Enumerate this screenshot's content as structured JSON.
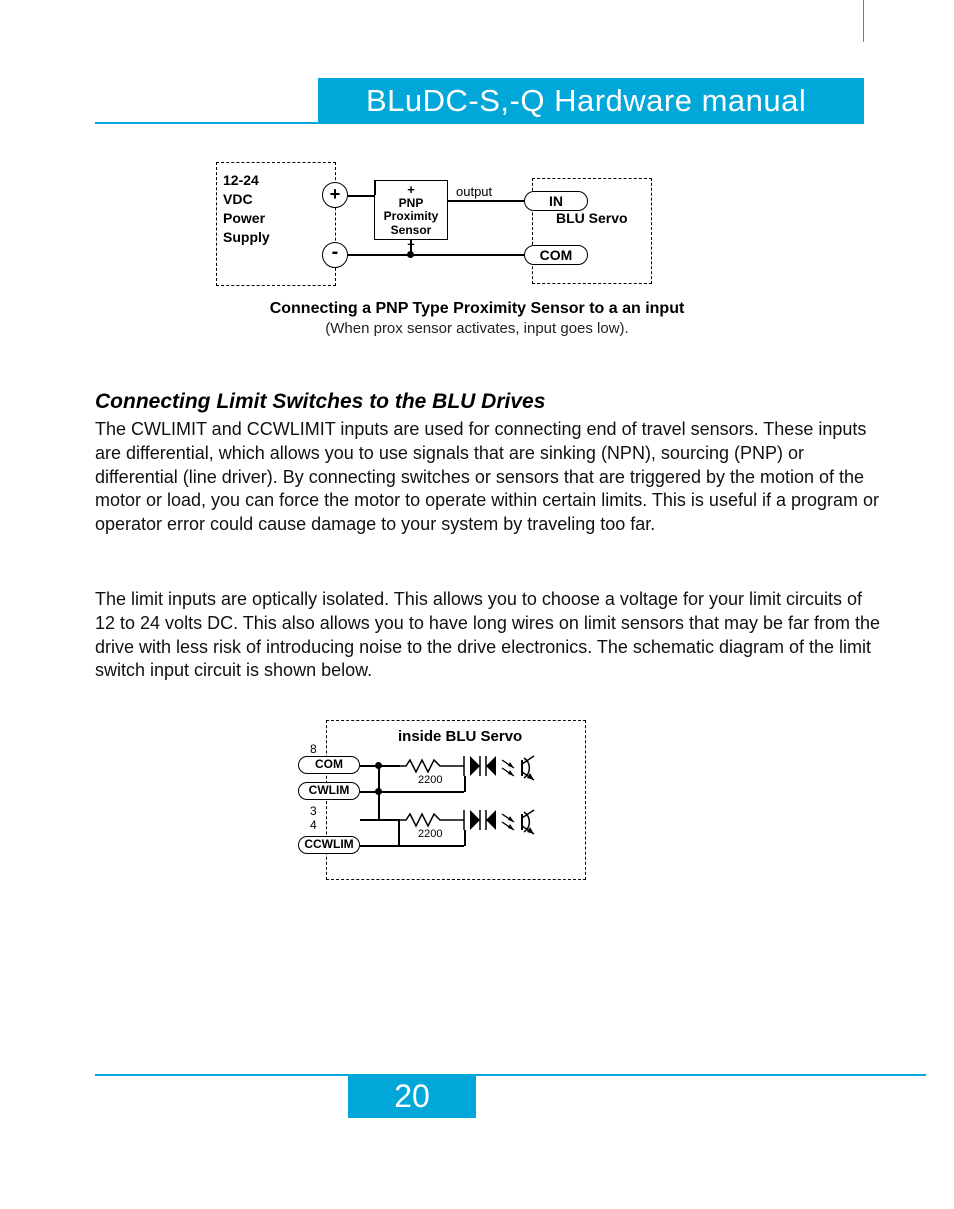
{
  "header": {
    "title": "BLuDC-S,-Q Hardware manual"
  },
  "diag1": {
    "ps_line1": "12-24",
    "ps_line2": "VDC",
    "ps_line3": "Power",
    "ps_line4": "Supply",
    "plus": "+",
    "minus": "-",
    "sensor_plus": "+",
    "sensor_l1": "PNP",
    "sensor_l2": "Proximity",
    "sensor_l3": "Sensor",
    "sensor_minus": "–",
    "output": "output",
    "in": "IN",
    "com": "COM",
    "servo": "BLU Servo",
    "caption1": "Connecting a PNP Type Proximity Sensor to a an input",
    "caption2": "(When prox sensor activates, input goes low)."
  },
  "section": {
    "heading": "Connecting Limit Switches to the BLU Drives",
    "p1": "The CWLIMIT and CCWLIMIT inputs are used for connecting end of travel sensors.  These inputs are differential, which allows you to use signals that are sinking (NPN), sourcing (PNP) or differential (line driver).  By connecting switches or sensors that are triggered by the motion of the motor or load, you can force the motor to operate within certain limits.  This is useful if a program or operator error could cause damage to your system by traveling too far.",
    "p2": "The limit inputs are optically isolated.  This allows you to choose a voltage for your limit circuits of 12 to 24 volts DC.  This also allows you to have long wires on limit sensors that may be far from the drive with less risk of introducing noise to the drive electronics.  The schematic diagram of the limit switch input circuit is shown below."
  },
  "diag2": {
    "inside": "inside BLU Servo",
    "pin8": "8",
    "com": "COM",
    "cwlim": "CWLIM",
    "pin3": "3",
    "pin4": "4",
    "ccwlim": "CCWLIM",
    "r1": "2200",
    "r2": "2200"
  },
  "footer": {
    "page": "20"
  }
}
